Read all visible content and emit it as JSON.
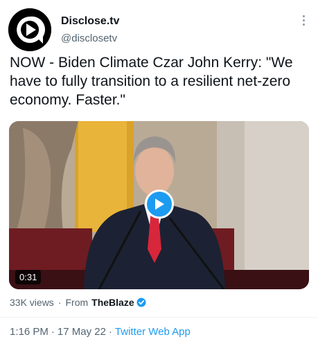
{
  "author": {
    "display_name": "Disclose.tv",
    "handle": "@disclosetv",
    "avatar_icon": "play-speech-bubble-logo"
  },
  "more_icon": "more-vertical-icon",
  "tweet": {
    "text": "NOW - Biden Climate Czar John Kerry: \"We have to fully transition to a resilient net-zero economy. Faster.\""
  },
  "media": {
    "duration": "0:31",
    "play_icon": "play-icon"
  },
  "stats": {
    "views": "33K views",
    "separator": "·",
    "from_label": "From",
    "source_name": "TheBlaze",
    "verified_icon": "verified-badge-icon"
  },
  "footer": {
    "time": "1:16 PM",
    "sep1": "·",
    "date": "17 May 22",
    "sep2": "·",
    "client": "Twitter Web App"
  },
  "colors": {
    "accent": "#1d9bf0",
    "text_primary": "#0f1419",
    "text_secondary": "#536471",
    "tie": "#d8263a"
  }
}
